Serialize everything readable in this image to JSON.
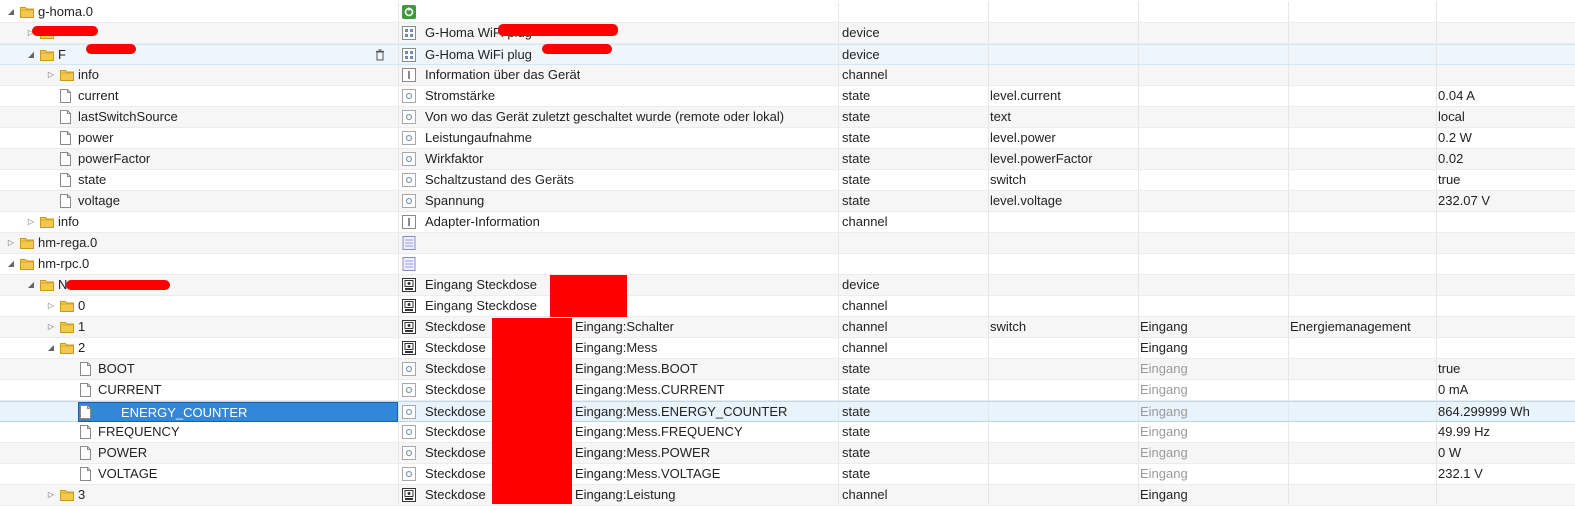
{
  "rows": [
    {
      "id": "g-homa.0",
      "indent": 0,
      "expand": "open",
      "icon": "folder",
      "name": "",
      "type": "",
      "role": "",
      "room": "",
      "func": "",
      "value": "",
      "ticon": "adapter"
    },
    {
      "id": "",
      "indent": 1,
      "expand": "closed",
      "icon": "folder",
      "name": "G-Homa WiFi plug",
      "type": "device",
      "role": "",
      "room": "",
      "func": "",
      "value": "",
      "ticon": "device"
    },
    {
      "id": "F",
      "indent": 1,
      "expand": "open",
      "icon": "folder",
      "name": "G-Homa WiFi plug",
      "type": "device",
      "role": "",
      "room": "",
      "func": "",
      "value": "",
      "ticon": "device",
      "hover": true
    },
    {
      "id": "info",
      "indent": 2,
      "expand": "closed",
      "icon": "folder",
      "name": "Information über das Gerät",
      "type": "channel",
      "role": "",
      "room": "",
      "func": "",
      "value": "",
      "ticon": "channel"
    },
    {
      "id": "current",
      "indent": 2,
      "expand": "",
      "icon": "file",
      "name": "Stromstärke",
      "type": "state",
      "role": "level.current",
      "room": "",
      "func": "",
      "value": "0.04 A",
      "ticon": "state"
    },
    {
      "id": "lastSwitchSource",
      "indent": 2,
      "expand": "",
      "icon": "file",
      "name": "Von wo das Gerät zuletzt geschaltet wurde (remote oder lokal)",
      "type": "state",
      "role": "text",
      "room": "",
      "func": "",
      "value": "local",
      "ticon": "state"
    },
    {
      "id": "power",
      "indent": 2,
      "expand": "",
      "icon": "file",
      "name": "Leistungaufnahme",
      "type": "state",
      "role": "level.power",
      "room": "",
      "func": "",
      "value": "0.2 W",
      "ticon": "state"
    },
    {
      "id": "powerFactor",
      "indent": 2,
      "expand": "",
      "icon": "file",
      "name": "Wirkfaktor",
      "type": "state",
      "role": "level.powerFactor",
      "room": "",
      "func": "",
      "value": "0.02",
      "ticon": "state"
    },
    {
      "id": "state",
      "indent": 2,
      "expand": "",
      "icon": "file",
      "name": "Schaltzustand des Geräts",
      "type": "state",
      "role": "switch",
      "room": "",
      "func": "",
      "value": "true",
      "ticon": "state"
    },
    {
      "id": "voltage",
      "indent": 2,
      "expand": "",
      "icon": "file",
      "name": "Spannung",
      "type": "state",
      "role": "level.voltage",
      "room": "",
      "func": "",
      "value": "232.07 V",
      "ticon": "state"
    },
    {
      "id": "info",
      "indent": 1,
      "expand": "closed",
      "icon": "folder",
      "name": "Adapter-Information",
      "type": "channel",
      "role": "",
      "room": "",
      "func": "",
      "value": "",
      "ticon": "channel"
    },
    {
      "id": "hm-rega.0",
      "indent": 0,
      "expand": "closed",
      "icon": "folder",
      "name": "",
      "type": "",
      "role": "",
      "room": "",
      "func": "",
      "value": "",
      "ticon": "instance"
    },
    {
      "id": "hm-rpc.0",
      "indent": 0,
      "expand": "open",
      "icon": "folder",
      "name": "",
      "type": "",
      "role": "",
      "room": "",
      "func": "",
      "value": "",
      "ticon": "instance"
    },
    {
      "id": "N",
      "indent": 1,
      "expand": "open",
      "icon": "folder",
      "name": "Eingang Steckdose",
      "type": "device",
      "role": "",
      "room": "",
      "func": "",
      "value": "",
      "ticon": "hm"
    },
    {
      "id": "0",
      "indent": 2,
      "expand": "closed",
      "icon": "folder",
      "name": "Eingang Steckdose",
      "name2": ":0",
      "type": "channel",
      "role": "",
      "room": "",
      "func": "",
      "value": "",
      "ticon": "hm"
    },
    {
      "id": "1",
      "indent": 2,
      "expand": "closed",
      "icon": "folder",
      "name": "Steckdose",
      "name2": "Eingang:Schalter",
      "type": "channel",
      "role": "switch",
      "room": "Eingang",
      "func": "Energiemanagement",
      "value": "",
      "ticon": "hm"
    },
    {
      "id": "2",
      "indent": 2,
      "expand": "open",
      "icon": "folder",
      "name": "Steckdose",
      "name2": "Eingang:Mess",
      "type": "channel",
      "role": "",
      "room": "Eingang",
      "func": "",
      "value": "",
      "ticon": "hm"
    },
    {
      "id": "BOOT",
      "indent": 3,
      "expand": "",
      "icon": "file",
      "name": "Steckdose",
      "name2": "Eingang:Mess.BOOT",
      "type": "state",
      "role": "",
      "room": "Eingang",
      "roomMuted": true,
      "func": "",
      "value": "true",
      "ticon": "state"
    },
    {
      "id": "CURRENT",
      "indent": 3,
      "expand": "",
      "icon": "file",
      "name": "Steckdose",
      "name2": "Eingang:Mess.CURRENT",
      "type": "state",
      "role": "",
      "room": "Eingang",
      "roomMuted": true,
      "func": "",
      "value": "0 mA",
      "ticon": "state"
    },
    {
      "id": "ENERGY_COUNTER",
      "indent": 3,
      "expand": "",
      "icon": "file",
      "name": "Steckdose",
      "name2": "Eingang:Mess.ENERGY_COUNTER",
      "type": "state",
      "role": "",
      "room": "Eingang",
      "roomMuted": true,
      "func": "",
      "value": "864.299999 Wh",
      "ticon": "state",
      "selected": true
    },
    {
      "id": "FREQUENCY",
      "indent": 3,
      "expand": "",
      "icon": "file",
      "name": "Steckdose",
      "name2": "Eingang:Mess.FREQUENCY",
      "type": "state",
      "role": "",
      "room": "Eingang",
      "roomMuted": true,
      "func": "",
      "value": "49.99 Hz",
      "ticon": "state"
    },
    {
      "id": "POWER",
      "indent": 3,
      "expand": "",
      "icon": "file",
      "name": "Steckdose",
      "name2": "Eingang:Mess.POWER",
      "type": "state",
      "role": "",
      "room": "Eingang",
      "roomMuted": true,
      "func": "",
      "value": "0 W",
      "ticon": "state"
    },
    {
      "id": "VOLTAGE",
      "indent": 3,
      "expand": "",
      "icon": "file",
      "name": "Steckdose",
      "name2": "Eingang:Mess.VOLTAGE",
      "type": "state",
      "role": "",
      "room": "Eingang",
      "roomMuted": true,
      "func": "",
      "value": "232.1 V",
      "ticon": "state"
    },
    {
      "id": "3",
      "indent": 2,
      "expand": "closed",
      "icon": "folder",
      "name": "Steckdose",
      "name2": "Eingang:Leistung",
      "type": "channel",
      "role": "",
      "room": "Eingang",
      "func": "",
      "value": "",
      "ticon": "hm"
    }
  ],
  "colors": {
    "selection": "#3287d8",
    "redaction": "#ff0000",
    "folder": "#e7b53c"
  }
}
